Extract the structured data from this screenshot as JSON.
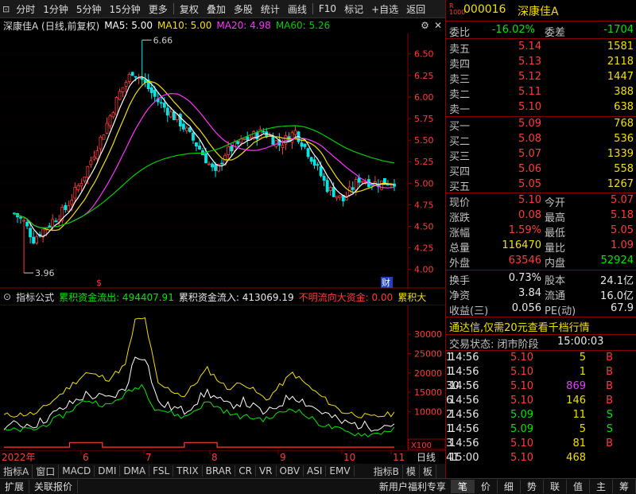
{
  "toolbar": {
    "items": [
      "分时",
      "1分钟",
      "5分钟",
      "15分钟",
      "更多",
      "复权",
      "叠加",
      "多股",
      "统计",
      "画线",
      "F10",
      "标记",
      "+自选",
      "返回"
    ],
    "icons": [
      "target-icon",
      "arrow-left-icon",
      "arrow-right-icon",
      "zoom-in-icon",
      "zoom-out-icon"
    ]
  },
  "chart_header": {
    "title": "深康佳A (日线,前复权)",
    "ma5": "MA5: 5.00",
    "ma10": "MA10: 5.00",
    "ma20": "MA20: 4.98",
    "ma60": "MA60: 5.26"
  },
  "price_chart": {
    "y_ticks": [
      "6.50",
      "6.25",
      "6.00",
      "5.75",
      "5.50",
      "5.25",
      "5.00",
      "4.75",
      "4.50",
      "4.25",
      "4.00"
    ],
    "high_label": "6.66",
    "low_label": "3.96",
    "markers": [
      "$",
      "财"
    ]
  },
  "indicator": {
    "name": "指标公式",
    "out_label": "累积资金流出: 494407.91",
    "in_label": "累积资金流入: 413069.19",
    "unknown_label": "不明流向大资金: 0.00",
    "extra_label": "累积大",
    "y_ticks": [
      "30000",
      "25000",
      "20000",
      "15000",
      "10000"
    ],
    "unit": "X100"
  },
  "x_axis": {
    "labels": [
      "2022年",
      "6",
      "7",
      "8",
      "9",
      "10",
      "11"
    ],
    "period": "日线"
  },
  "indicator_tabs": [
    "指标A",
    "窗口",
    "MACD",
    "DMI",
    "DMA",
    "FSL",
    "TRIX",
    "BRAR",
    "CR",
    "VR",
    "OBV",
    "ASI",
    "EMV",
    "指标B",
    "模",
    "板"
  ],
  "status_bar": {
    "items": [
      "扩展",
      "关联报价"
    ],
    "promo": "新用户福利专享",
    "right_tabs": [
      "笔",
      "价",
      "细",
      "势",
      "联",
      "值",
      "主",
      "筹"
    ]
  },
  "quote": {
    "code_badge": "R 1000",
    "code": "000016",
    "name": "深康佳A",
    "weibi_label": "委比",
    "weibi": "-16.02%",
    "weicha_label": "委差",
    "weicha": "-1704",
    "sells": [
      {
        "label": "卖五",
        "price": "5.14",
        "vol": "1581"
      },
      {
        "label": "卖四",
        "price": "5.13",
        "vol": "2118"
      },
      {
        "label": "卖三",
        "price": "5.12",
        "vol": "1447"
      },
      {
        "label": "卖二",
        "price": "5.11",
        "vol": "388"
      },
      {
        "label": "卖一",
        "price": "5.10",
        "vol": "638"
      }
    ],
    "buys": [
      {
        "label": "买一",
        "price": "5.09",
        "vol": "768"
      },
      {
        "label": "买二",
        "price": "5.08",
        "vol": "536"
      },
      {
        "label": "买三",
        "price": "5.07",
        "vol": "1339"
      },
      {
        "label": "买四",
        "price": "5.06",
        "vol": "558"
      },
      {
        "label": "买五",
        "price": "5.05",
        "vol": "1267"
      }
    ],
    "stats": [
      {
        "l1": "现价",
        "v1": "5.10",
        "l2": "今开",
        "v2": "5.07"
      },
      {
        "l1": "涨跌",
        "v1": "0.08",
        "l2": "最高",
        "v2": "5.18"
      },
      {
        "l1": "涨幅",
        "v1": "1.59%",
        "l2": "最低",
        "v2": "5.05"
      },
      {
        "l1": "总量",
        "v1": "116470",
        "l2": "量比",
        "v2": "1.09"
      },
      {
        "l1": "外盘",
        "v1": "63546",
        "l2": "内盘",
        "v2": "52924"
      }
    ],
    "stats2": [
      {
        "l1": "换手",
        "v1": "0.73%",
        "l2": "股本",
        "v2": "24.1亿"
      },
      {
        "l1": "净资",
        "v1": "3.84",
        "l2": "流通",
        "v2": "16.0亿"
      },
      {
        "l1": "收益(三)",
        "v1": "0.056",
        "l2": "PE(动)",
        "v2": "67.9"
      }
    ],
    "ad": "通达信,仅需20元查看千档行情",
    "trade_state_label": "交易状态: 闭市阶段",
    "trade_time": "15:00:03",
    "ticks": [
      {
        "t": "14:56",
        "p": "5.10",
        "v": "5",
        "d": "B",
        "n": "1"
      },
      {
        "t": "14:56",
        "p": "5.10",
        "v": "1",
        "d": "B",
        "n": "1"
      },
      {
        "t": "14:56",
        "p": "5.10",
        "v": "869",
        "d": "B",
        "n": "30"
      },
      {
        "t": "14:56",
        "p": "5.10",
        "v": "146",
        "d": "B",
        "n": "6"
      },
      {
        "t": "14:56",
        "p": "5.09",
        "v": "11",
        "d": "S",
        "n": "2"
      },
      {
        "t": "14:56",
        "p": "5.09",
        "v": "5",
        "d": "S",
        "n": "1"
      },
      {
        "t": "14:56",
        "p": "5.10",
        "v": "81",
        "d": "B",
        "n": "3"
      },
      {
        "t": "15:00",
        "p": "5.10",
        "v": "468",
        "d": "",
        "n": "41"
      }
    ]
  },
  "colors": {
    "up": "#ff3b3b",
    "down": "#00e600",
    "ma5": "#ffffff",
    "ma10": "#f0e000",
    "ma20": "#ff33ff",
    "ma60": "#00cc00",
    "grid": "#8b0000"
  }
}
